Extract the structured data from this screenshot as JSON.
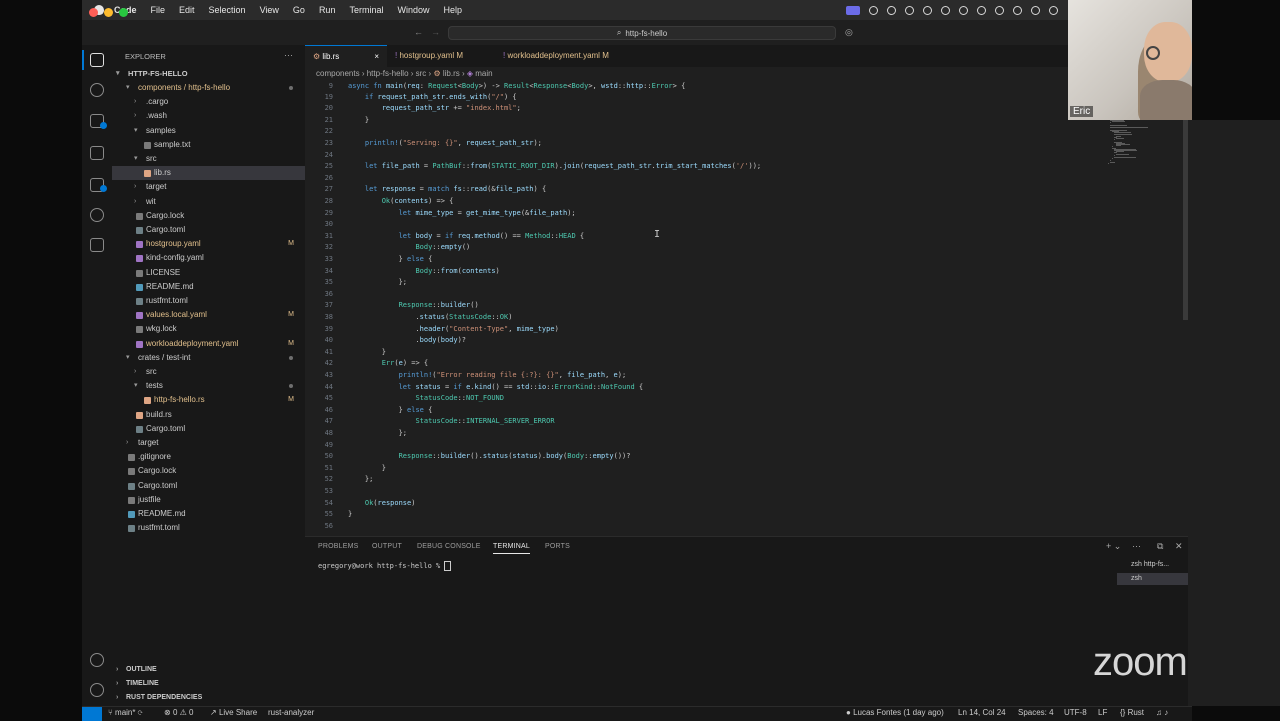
{
  "menubar": {
    "items": [
      "Code",
      "File",
      "Edit",
      "Selection",
      "View",
      "Go",
      "Run",
      "Terminal",
      "Window",
      "Help"
    ]
  },
  "titlebar": {
    "search_text": "http-fs-hello"
  },
  "sidebar": {
    "title": "EXPLORER",
    "root": "HTTP-FS-HELLO",
    "tree": [
      {
        "label": "components / http-fs-hello",
        "type": "folder-open",
        "badge": "",
        "color": "#e2c08d",
        "dot": true
      },
      {
        "label": ".cargo",
        "type": "folder",
        "badge": ""
      },
      {
        "label": ".wash",
        "type": "folder",
        "badge": ""
      },
      {
        "label": "samples",
        "type": "folder-open",
        "badge": ""
      },
      {
        "label": "sample.txt",
        "type": "file",
        "badge": ""
      },
      {
        "label": "src",
        "type": "folder-open",
        "badge": ""
      },
      {
        "label": "lib.rs",
        "type": "file",
        "badge": "",
        "selected": true
      },
      {
        "label": "target",
        "type": "folder",
        "badge": ""
      },
      {
        "label": "wit",
        "type": "folder",
        "badge": ""
      },
      {
        "label": "Cargo.lock",
        "type": "file",
        "badge": ""
      },
      {
        "label": "Cargo.toml",
        "type": "file",
        "badge": ""
      },
      {
        "label": "hostgroup.yaml",
        "type": "file",
        "badge": "M",
        "color": "#e2c08d"
      },
      {
        "label": "kind-config.yaml",
        "type": "file",
        "badge": ""
      },
      {
        "label": "LICENSE",
        "type": "file",
        "badge": ""
      },
      {
        "label": "README.md",
        "type": "file",
        "badge": ""
      },
      {
        "label": "rustfmt.toml",
        "type": "file",
        "badge": ""
      },
      {
        "label": "values.local.yaml",
        "type": "file",
        "badge": "M",
        "color": "#e2c08d"
      },
      {
        "label": "wkg.lock",
        "type": "file",
        "badge": ""
      },
      {
        "label": "workloaddeployment.yaml",
        "type": "file",
        "badge": "M",
        "color": "#e2c08d"
      },
      {
        "label": "crates / test-int",
        "type": "folder-open",
        "badge": "",
        "dot": true
      },
      {
        "label": "src",
        "type": "folder",
        "badge": ""
      },
      {
        "label": "tests",
        "type": "folder-open",
        "badge": "",
        "dot": true
      },
      {
        "label": "http-fs-hello.rs",
        "type": "file",
        "badge": "M",
        "color": "#e2c08d"
      },
      {
        "label": "build.rs",
        "type": "file",
        "badge": ""
      },
      {
        "label": "Cargo.toml",
        "type": "file",
        "badge": ""
      },
      {
        "label": "target",
        "type": "folder",
        "badge": ""
      },
      {
        "label": ".gitignore",
        "type": "file",
        "badge": ""
      },
      {
        "label": "Cargo.lock",
        "type": "file",
        "badge": ""
      },
      {
        "label": "Cargo.toml",
        "type": "file",
        "badge": ""
      },
      {
        "label": "justfile",
        "type": "file",
        "badge": ""
      },
      {
        "label": "README.md",
        "type": "file",
        "badge": ""
      },
      {
        "label": "rustfmt.toml",
        "type": "file",
        "badge": ""
      }
    ],
    "bottom_sections": [
      "OUTLINE",
      "TIMELINE",
      "RUST DEPENDENCIES"
    ]
  },
  "tabs": [
    {
      "label": "lib.rs",
      "modified": "",
      "active": true,
      "close": "×"
    },
    {
      "label": "hostgroup.yaml",
      "modified": "M",
      "active": false
    },
    {
      "label": "workloaddeployment.yaml",
      "modified": "M",
      "active": false
    }
  ],
  "breadcrumb": [
    "components",
    "http-fs-hello",
    "src",
    "lib.rs",
    "main"
  ],
  "editor": {
    "sticky": {
      "num": "9",
      "text": "async fn main(req: Request<Body>) -> Result<Response<Body>, wstd::http::Error> {"
    },
    "lines": [
      {
        "num": "19",
        "text": "    if request_path_str.ends_with(\"/\") {"
      },
      {
        "num": "20",
        "text": "        request_path_str += \"index.html\";"
      },
      {
        "num": "21",
        "text": "    }"
      },
      {
        "num": "22",
        "text": ""
      },
      {
        "num": "23",
        "text": "    println!(\"Serving: {}\", request_path_str);"
      },
      {
        "num": "24",
        "text": ""
      },
      {
        "num": "25",
        "text": "    let file_path = PathBuf::from(STATIC_ROOT_DIR).join(request_path_str.trim_start_matches('/'));"
      },
      {
        "num": "26",
        "text": ""
      },
      {
        "num": "27",
        "text": "    let response = match fs::read(&file_path) {"
      },
      {
        "num": "28",
        "text": "        Ok(contents) => {"
      },
      {
        "num": "29",
        "text": "            let mime_type = get_mime_type(&file_path);"
      },
      {
        "num": "30",
        "text": ""
      },
      {
        "num": "31",
        "text": "            let body = if req.method() == Method::HEAD {"
      },
      {
        "num": "32",
        "text": "                Body::empty()"
      },
      {
        "num": "33",
        "text": "            } else {"
      },
      {
        "num": "34",
        "text": "                Body::from(contents)"
      },
      {
        "num": "35",
        "text": "            };"
      },
      {
        "num": "36",
        "text": ""
      },
      {
        "num": "37",
        "text": "            Response::builder()"
      },
      {
        "num": "38",
        "text": "                .status(StatusCode::OK)"
      },
      {
        "num": "39",
        "text": "                .header(\"Content-Type\", mime_type)"
      },
      {
        "num": "40",
        "text": "                .body(body)?"
      },
      {
        "num": "41",
        "text": "        }"
      },
      {
        "num": "42",
        "text": "        Err(e) => {"
      },
      {
        "num": "43",
        "text": "            println!(\"Error reading file {:?}: {}\", file_path, e);"
      },
      {
        "num": "44",
        "text": "            let status = if e.kind() == std::io::ErrorKind::NotFound {"
      },
      {
        "num": "45",
        "text": "                StatusCode::NOT_FOUND"
      },
      {
        "num": "46",
        "text": "            } else {"
      },
      {
        "num": "47",
        "text": "                StatusCode::INTERNAL_SERVER_ERROR"
      },
      {
        "num": "48",
        "text": "            };"
      },
      {
        "num": "49",
        "text": ""
      },
      {
        "num": "50",
        "text": "            Response::builder().status(status).body(Body::empty())?"
      },
      {
        "num": "51",
        "text": "        }"
      },
      {
        "num": "52",
        "text": "    };"
      },
      {
        "num": "53",
        "text": ""
      },
      {
        "num": "54",
        "text": "    Ok(response)"
      },
      {
        "num": "55",
        "text": "}"
      },
      {
        "num": "56",
        "text": ""
      }
    ]
  },
  "panel": {
    "tabs": [
      "PROBLEMS",
      "OUTPUT",
      "DEBUG CONSOLE",
      "TERMINAL",
      "PORTS"
    ],
    "active_tab": "TERMINAL",
    "prompt": "egregory@work http-fs-hello % ",
    "terminals": [
      "zsh http-fs...",
      "zsh"
    ]
  },
  "statusbar": {
    "branch": "main*",
    "errors": "0",
    "warnings": "0",
    "live_share": "Live Share",
    "rust_analyzer": "rust-analyzer",
    "blame": "Lucas Fontes (1 day ago)",
    "position": "Ln 14, Col 24",
    "spaces": "Spaces: 4",
    "encoding": "UTF-8",
    "eol": "LF",
    "language": "Rust"
  },
  "video": {
    "participant_name": "Eric"
  },
  "zoom_logo": "zoom",
  "colors": {
    "accent": "#0078d4",
    "modified": "#e2c08d",
    "editor_bg": "#1f1f1f",
    "sidebar_bg": "#181818"
  }
}
